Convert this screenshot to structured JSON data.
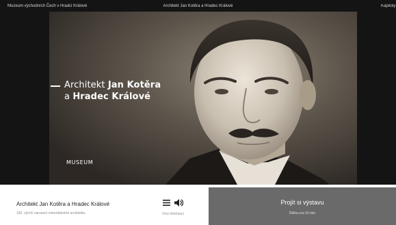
{
  "topbar": {
    "museum_link": "Muzeum východních Čech v Hradci Králové",
    "title": "Architekt Jan Kotěra a Hradec Králové",
    "chapters_link": "Kapitoly"
  },
  "hero": {
    "title_line1_regular": "Architekt ",
    "title_line1_bold": "Jan Kotěra",
    "title_line2_regular": "a ",
    "title_line2_bold": "Hradec Králové",
    "logo_text": "MUSEUM",
    "image_description": "sepia-portrait-photo"
  },
  "info_card": {
    "title": "Architekt Jan Kotěra a Hradec Králové",
    "subtitle": "150. výročí narození mimořádného architekta",
    "menu_icon": "menu-icon",
    "sound_icon": "speaker-icon",
    "more_info_label": "Více informací"
  },
  "cta": {
    "label": "Projít si výstavu",
    "duration": "Délka cca 10 min"
  },
  "colors": {
    "topbar_bg": "#141414",
    "hero_bg": "#3b352f",
    "cta_bg": "#6a6a6a",
    "text_dark": "#222222",
    "text_muted": "#8a8a8a"
  }
}
